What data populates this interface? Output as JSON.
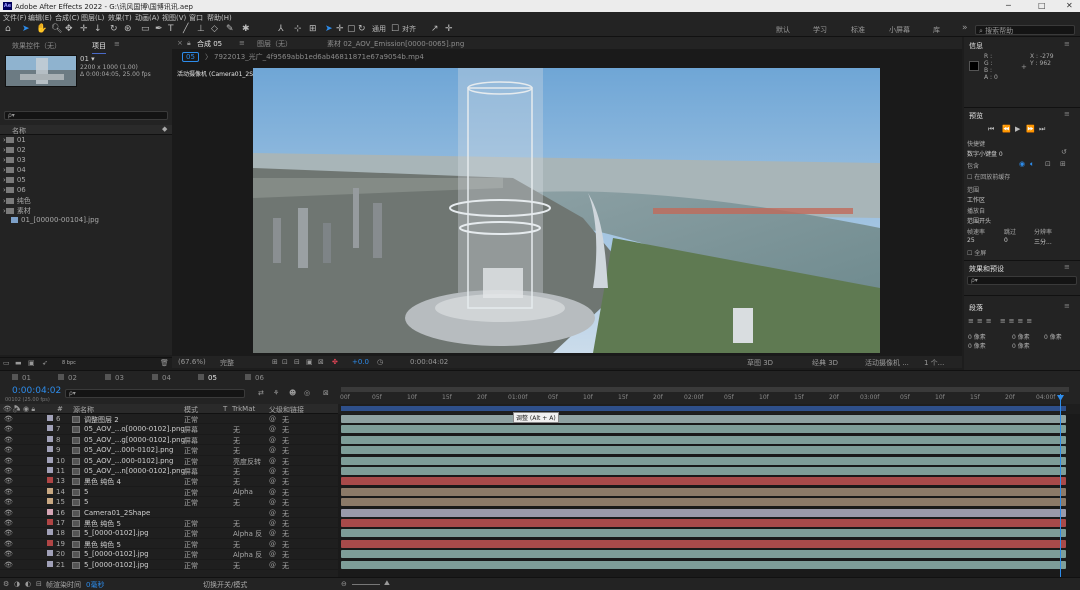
{
  "app": {
    "title": "Adobe After Effects 2022 - G:\\讯风国博\\国博讯讯.aep",
    "icon": "Ae"
  },
  "window_controls": {
    "minimize": "─",
    "maximize": "□",
    "close": "✕"
  },
  "menu": [
    "文件(F)",
    "编辑(E)",
    "合成(C)",
    "图层(L)",
    "效果(T)",
    "动画(A)",
    "视图(V)",
    "窗口",
    "帮助(H)"
  ],
  "toolbar": {
    "align_label": "对齐",
    "workspaces": [
      "默认",
      "学习",
      "标准",
      "小屏幕",
      "库"
    ],
    "more": "»",
    "search_placeholder": "搜索帮助"
  },
  "project": {
    "tabs": [
      "效果控件（无）",
      "项目"
    ],
    "item_name": "01 ▾",
    "item_info1": "2200 x 1000 (1.00)",
    "item_info2": "Δ 0:00:04:05, 25.00 fps",
    "search_placeholder": "ρ▾",
    "col_name": "名称",
    "items": [
      "01",
      "02",
      "03",
      "04",
      "05",
      "06",
      "纯色",
      "素材",
      "01_[00000-00104].jpg"
    ],
    "bpc": "8 bpc"
  },
  "comp": {
    "tabs": [
      "合成 05",
      "图层（无）",
      "素材 02_AOV_Emission[0000-0065].png"
    ],
    "flow_tab": "05",
    "breadcrumb": "7922013_光广_4f9569abb1ed6ab46811871e67a9054b.mp4",
    "camera_label": "活动摄像机 (Camera01_2Shape)",
    "zoom": "(67.6%)",
    "quality": "完整",
    "exposure": "+0.0",
    "timecode": "0:00:04:02",
    "renderer": "草图 3D",
    "renderer_mode": "经典 3D",
    "view_camera": "活动摄像机 ...",
    "views": "1 个..."
  },
  "info": {
    "title": "信息",
    "r": "R :",
    "g": "G :",
    "b": "B :",
    "a": "A : 0",
    "x": "X : -279",
    "y": "Y : 962"
  },
  "preview": {
    "title": "预览",
    "shortcut_label": "快捷键",
    "shortcut_value": "数字小键盘 0",
    "include": "包含",
    "cache_label": "在回放前缓存",
    "range_label": "范围",
    "range_value": "工作区",
    "playfrom_label": "播放自",
    "playfrom_value": "范围开头",
    "fps_label": "帧速率",
    "skip_label": "跳过",
    "res_label": "分辨率",
    "fps_value": "25",
    "skip_value": "0",
    "res_value": "三分...",
    "fullscreen_label": "全屏"
  },
  "effects": {
    "title": "效果和预设",
    "search_placeholder": "ρ▾"
  },
  "paragraph": {
    "title": "段落",
    "indent_values": [
      "0 像素",
      "0 像素",
      "0 像素",
      "0 像素",
      "0 像素"
    ]
  },
  "timeline": {
    "tabs": [
      "01",
      "02",
      "03",
      "04",
      "05",
      "06"
    ],
    "active_tab": "05",
    "timecode": "0:00:04:02",
    "timecode_sub": "00102 (25.00 fps)",
    "search_placeholder": "ρ▾",
    "headers": {
      "num": "#",
      "name": "源名称",
      "mode": "模式",
      "t": "T",
      "trkmat": "TrkMat",
      "parent": "父级和链接"
    },
    "ruler": [
      "00f",
      "05f",
      "10f",
      "15f",
      "20f",
      "01:00f",
      "05f",
      "10f",
      "15f",
      "20f",
      "02:00f",
      "05f",
      "10f",
      "15f",
      "20f",
      "03:00f",
      "05f",
      "10f",
      "15f",
      "20f",
      "04:00f"
    ],
    "tooltip": "调整 (Alt + A)",
    "layers": [
      {
        "num": "6",
        "name": "调整图层 2",
        "mode": "正常",
        "trk": "",
        "parent": "无",
        "color": "#a1a1b8",
        "bar": "#8ea1a1"
      },
      {
        "num": "7",
        "name": "05_AOV_...o[0000-0102].png",
        "mode": "屏幕",
        "trk": "无",
        "parent": "无",
        "color": "#a1a1b8",
        "bar": "#7e9d98"
      },
      {
        "num": "8",
        "name": "05_AOV_...g[0000-0102].png",
        "mode": "屏幕",
        "trk": "无",
        "parent": "无",
        "color": "#a1a1b8",
        "bar": "#7e9d98"
      },
      {
        "num": "9",
        "name": "05_AOV_...000-0102].png",
        "mode": "正常",
        "trk": "无",
        "parent": "无",
        "color": "#a1a1b8",
        "bar": "#7e9d98"
      },
      {
        "num": "10",
        "name": "05_AOV_...000-0102].png",
        "mode": "正常",
        "trk": "亮度反转",
        "parent": "无",
        "color": "#a1a1b8",
        "bar": "#7e9d98"
      },
      {
        "num": "11",
        "name": "05_AOV_...n[0000-0102].png",
        "mode": "屏幕",
        "trk": "无",
        "parent": "无",
        "color": "#a1a1b8",
        "bar": "#7e9d98"
      },
      {
        "num": "13",
        "name": "黑色 纯色 4",
        "mode": "正常",
        "trk": "无",
        "parent": "无",
        "color": "#b04545",
        "bar": "#a84a4a"
      },
      {
        "num": "14",
        "name": "5",
        "mode": "正常",
        "trk": "Alpha",
        "parent": "无",
        "color": "#c8a882",
        "bar": "#8c7a68"
      },
      {
        "num": "15",
        "name": "5",
        "mode": "正常",
        "trk": "无",
        "parent": "无",
        "color": "#c8a882",
        "bar": "#8c7a68"
      },
      {
        "num": "16",
        "name": "Camera01_2Shape",
        "mode": "",
        "trk": "",
        "parent": "无",
        "color": "#d5a5b5",
        "bar": "#9a9aaa"
      },
      {
        "num": "17",
        "name": "黑色 纯色 5",
        "mode": "正常",
        "trk": "无",
        "parent": "无",
        "color": "#b04545",
        "bar": "#a84a4a"
      },
      {
        "num": "18",
        "name": "5_[0000-0102].jpg",
        "mode": "正常",
        "trk": "Alpha 反",
        "parent": "无",
        "color": "#a1a1b8",
        "bar": "#7e9d98"
      },
      {
        "num": "19",
        "name": "黑色 纯色 5",
        "mode": "正常",
        "trk": "无",
        "parent": "无",
        "color": "#b04545",
        "bar": "#a84a4a"
      },
      {
        "num": "20",
        "name": "5_[0000-0102].jpg",
        "mode": "正常",
        "trk": "Alpha 反",
        "parent": "无",
        "color": "#a1a1b8",
        "bar": "#7e9d98"
      },
      {
        "num": "21",
        "name": "5_[0000-0102].jpg",
        "mode": "正常",
        "trk": "无",
        "parent": "无",
        "color": "#a1a1b8",
        "bar": "#7e9d98"
      }
    ],
    "footer_render_label": "帧渲染时间",
    "footer_render_value": "0毫秒",
    "footer_toggle": "切换开关/模式"
  },
  "colors": {
    "accent": "#2d8ceb",
    "bg": "#1d1d1d",
    "panel": "#232323",
    "timecode": "#2d8ceb"
  }
}
